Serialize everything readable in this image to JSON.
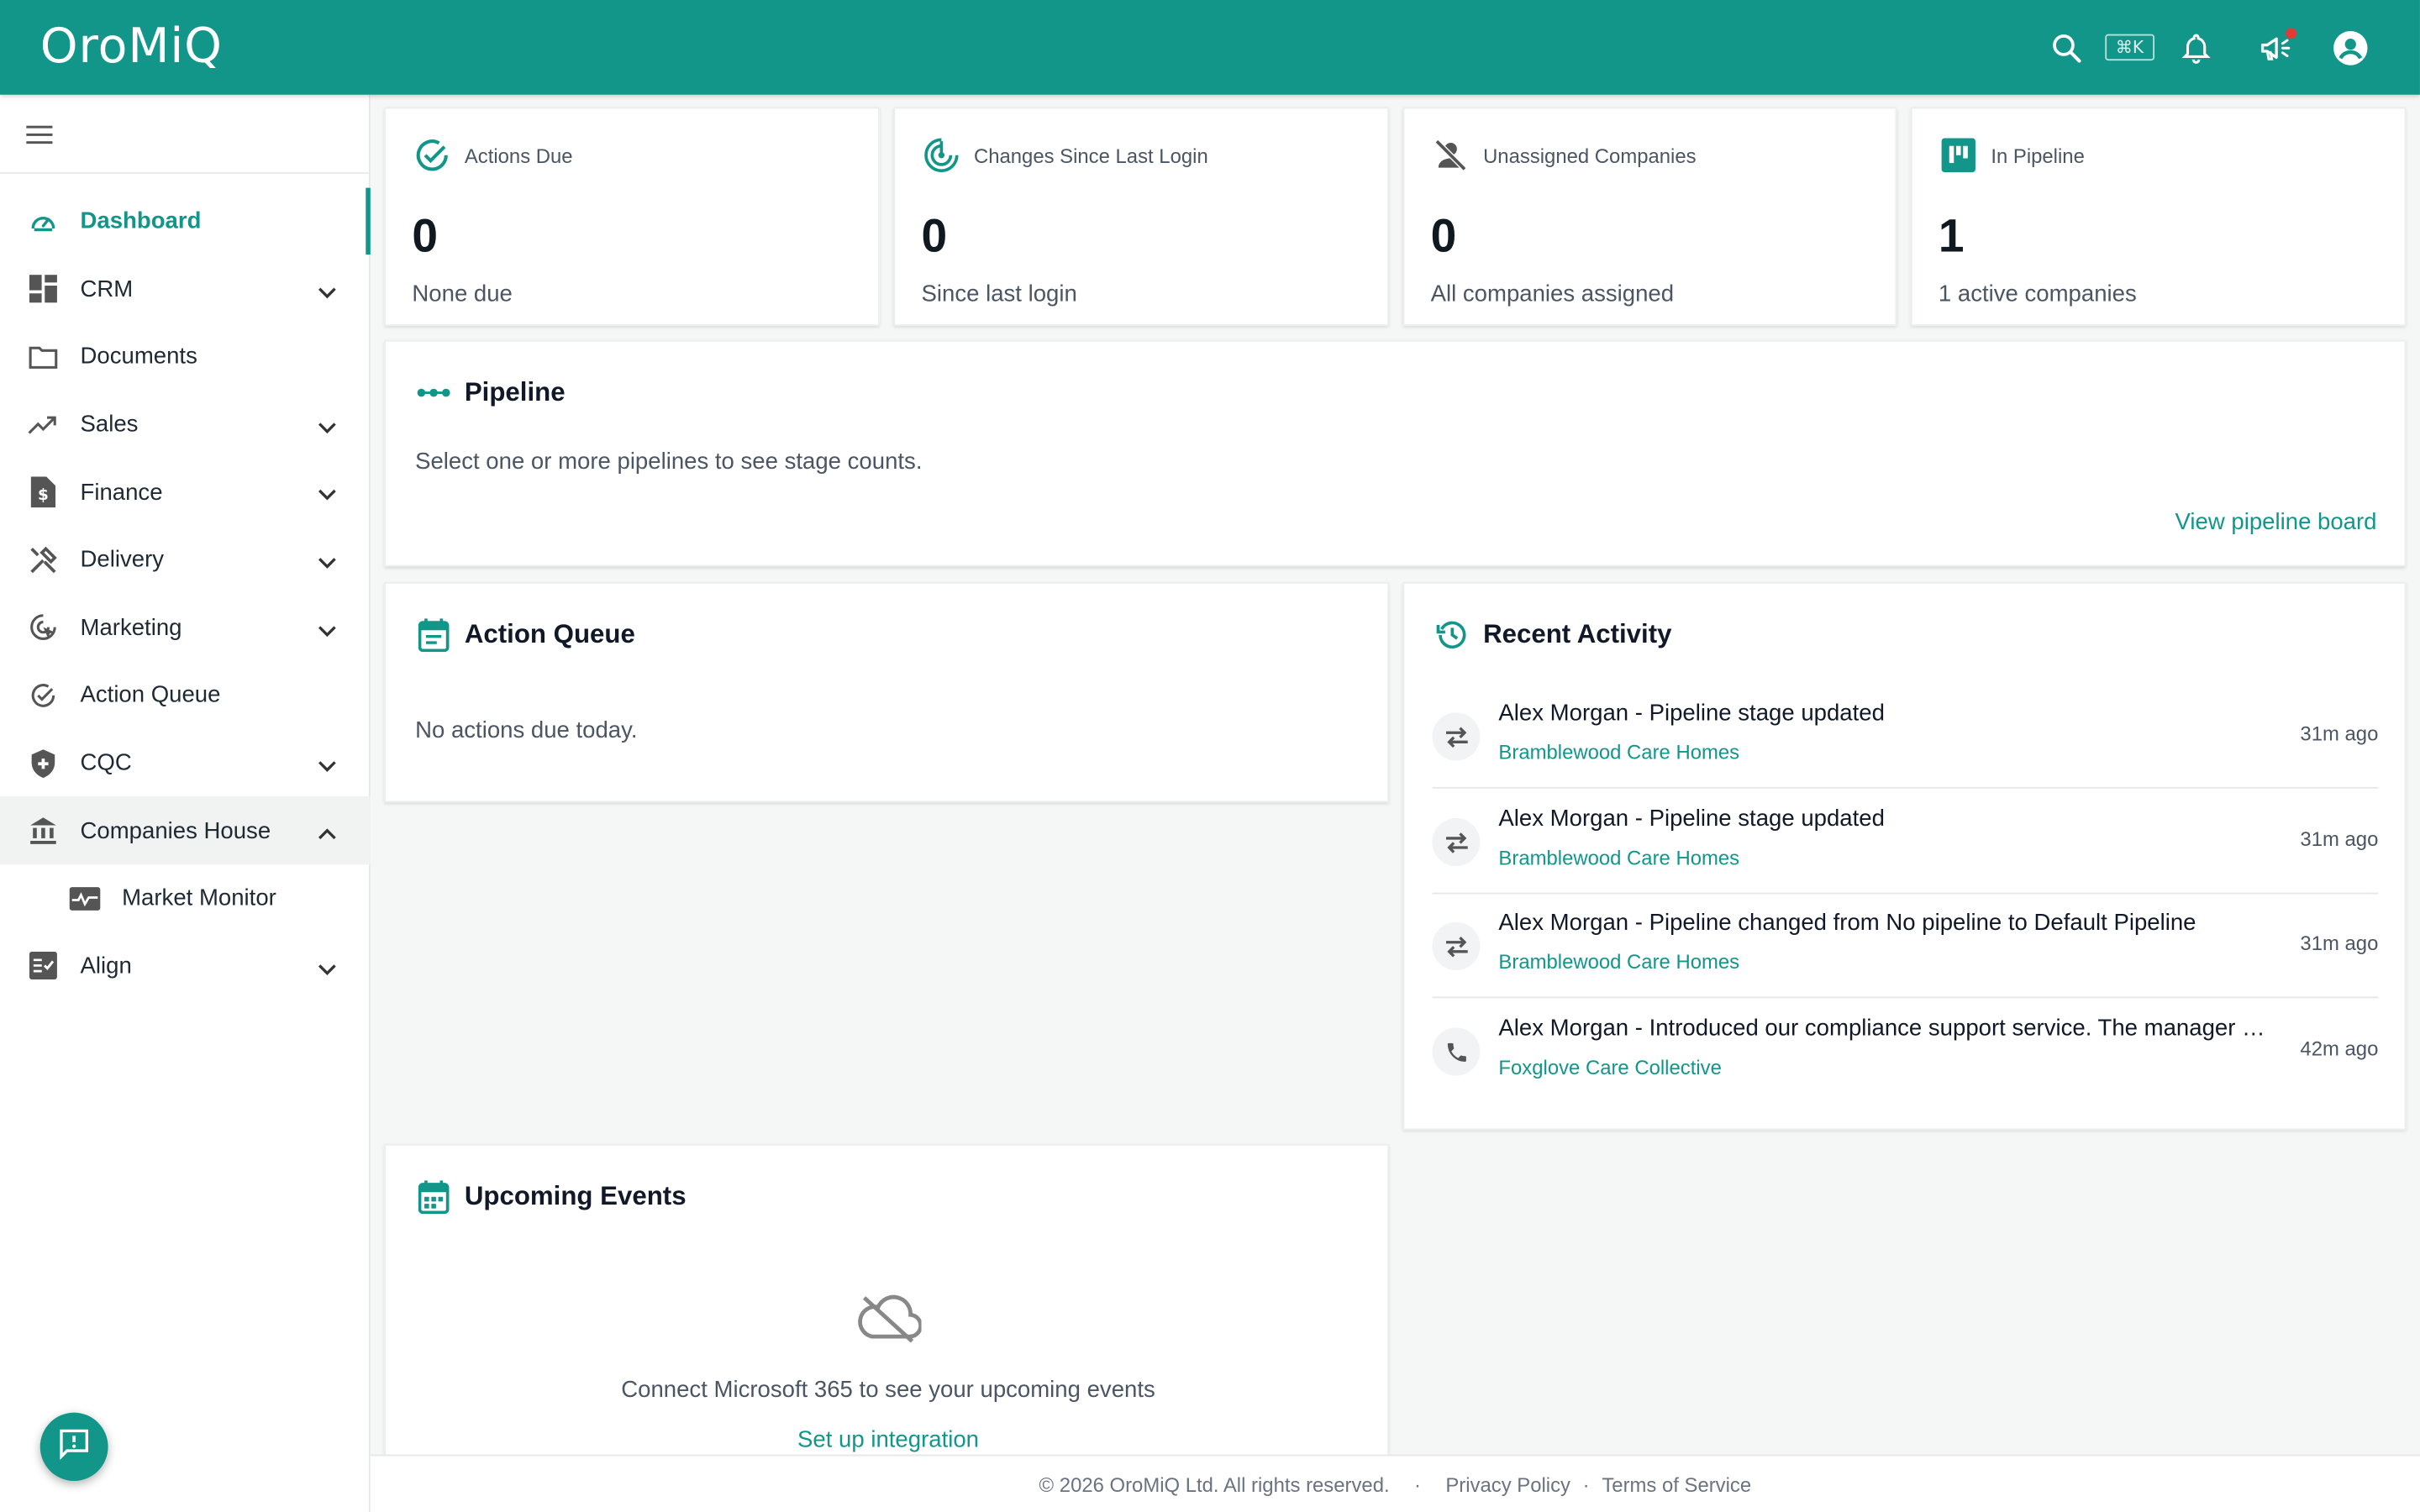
{
  "app": {
    "logo": "OroMiQ"
  },
  "topbar": {
    "shortcut_hint": "⌘K"
  },
  "sidebar": {
    "items": [
      {
        "label": "Dashboard",
        "icon": "gauge-icon",
        "expandable": false,
        "active": true
      },
      {
        "label": "CRM",
        "icon": "grid-icon",
        "expandable": true
      },
      {
        "label": "Documents",
        "icon": "folder-icon",
        "expandable": false
      },
      {
        "label": "Sales",
        "icon": "trending-up-icon",
        "expandable": true
      },
      {
        "label": "Finance",
        "icon": "invoice-icon",
        "expandable": true
      },
      {
        "label": "Delivery",
        "icon": "tools-icon",
        "expandable": true
      },
      {
        "label": "Marketing",
        "icon": "target-cursor-icon",
        "expandable": true
      },
      {
        "label": "Action Queue",
        "icon": "check-circle-icon",
        "expandable": false
      },
      {
        "label": "CQC",
        "icon": "shield-plus-icon",
        "expandable": true
      },
      {
        "label": "Companies House",
        "icon": "bank-icon",
        "expandable": true,
        "open": true
      },
      {
        "label": "Market Monitor",
        "icon": "monitor-heart-icon",
        "expandable": false,
        "sub": true
      },
      {
        "label": "Align",
        "icon": "checklist-icon",
        "expandable": true
      }
    ]
  },
  "stats": [
    {
      "label": "Actions Due",
      "value": "0",
      "sub": "None due",
      "icon": "check-circle-icon"
    },
    {
      "label": "Changes Since Last Login",
      "value": "0",
      "sub": "Since last login",
      "icon": "radar-icon"
    },
    {
      "label": "Unassigned Companies",
      "value": "0",
      "sub": "All companies assigned",
      "icon": "person-off-icon"
    },
    {
      "label": "In Pipeline",
      "value": "1",
      "sub": "1 active companies",
      "icon": "kanban-icon"
    }
  ],
  "pipeline": {
    "title": "Pipeline",
    "message": "Select one or more pipelines to see stage counts.",
    "link": "View pipeline board"
  },
  "action_queue": {
    "title": "Action Queue",
    "message": "No actions due today."
  },
  "recent_activity": {
    "title": "Recent Activity",
    "items": [
      {
        "title": "Alex Morgan - Pipeline stage updated",
        "company": "Bramblewood Care Homes",
        "time": "31m ago",
        "icon": "swap-icon"
      },
      {
        "title": "Alex Morgan - Pipeline stage updated",
        "company": "Bramblewood Care Homes",
        "time": "31m ago",
        "icon": "swap-icon"
      },
      {
        "title": "Alex Morgan - Pipeline changed from No pipeline to Default Pipeline",
        "company": "Bramblewood Care Homes",
        "time": "31m ago",
        "icon": "swap-icon"
      },
      {
        "title": "Alex Morgan - Introduced our compliance support service. The manager …",
        "company": "Foxglove Care Collective",
        "time": "42m ago",
        "icon": "phone-icon"
      }
    ]
  },
  "upcoming_events": {
    "title": "Upcoming Events",
    "message": "Connect Microsoft 365 to see your upcoming events",
    "link": "Set up integration"
  },
  "footer": {
    "copyright": "© 2026 OroMiQ Ltd. All rights reserved.",
    "separator": "·",
    "privacy": "Privacy Policy",
    "terms": "Terms of Service"
  },
  "colors": {
    "brand": "#12968a",
    "notification_dot": "#e53935"
  }
}
